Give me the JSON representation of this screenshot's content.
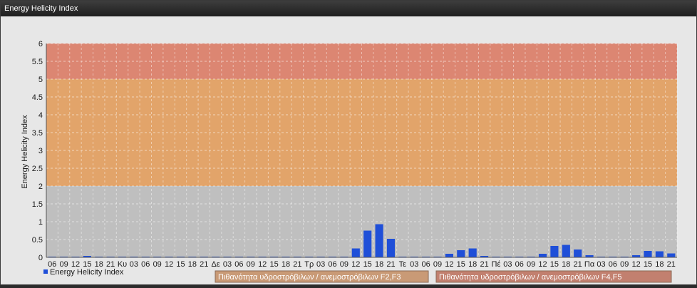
{
  "window": {
    "title": "Energy Helicity Index"
  },
  "chart_data": {
    "type": "bar",
    "ylabel": "Energy Helicity Index",
    "ylim": [
      0,
      6
    ],
    "yticks": [
      "0",
      "0.5",
      "1",
      "1.5",
      "2",
      "2.5",
      "3",
      "3.5",
      "4",
      "4.5",
      "5",
      "5.5",
      "6"
    ],
    "categories": [
      "06",
      "09",
      "12",
      "15",
      "18",
      "21",
      "Κυ",
      "03",
      "06",
      "09",
      "12",
      "15",
      "18",
      "21",
      "Δε",
      "03",
      "06",
      "09",
      "12",
      "15",
      "18",
      "21",
      "Τρ",
      "03",
      "06",
      "09",
      "12",
      "15",
      "18",
      "21",
      "Τε",
      "03",
      "06",
      "09",
      "12",
      "15",
      "18",
      "21",
      "Πέ",
      "03",
      "06",
      "09",
      "12",
      "15",
      "18",
      "21",
      "Πα",
      "03",
      "06",
      "09",
      "12",
      "15",
      "18",
      "21"
    ],
    "series": [
      {
        "name": "Energy Helicity Index",
        "color": "#1f4fd8",
        "values": [
          0.02,
          0.02,
          0.02,
          0.04,
          0.02,
          0.02,
          0.02,
          0.02,
          0.02,
          0.02,
          0.02,
          0.02,
          0.02,
          0.02,
          0.02,
          0.02,
          0.02,
          0.02,
          0.02,
          0.02,
          0.02,
          0.02,
          0.02,
          0.02,
          0.02,
          0.02,
          0.25,
          0.75,
          0.93,
          0.52,
          0.02,
          0.02,
          0.02,
          0.02,
          0.1,
          0.2,
          0.25,
          0.04,
          0.02,
          0.02,
          0.02,
          0.02,
          0.1,
          0.32,
          0.35,
          0.22,
          0.06,
          0.02,
          0.02,
          0.02,
          0.06,
          0.18,
          0.17,
          0.11
        ]
      }
    ],
    "bands": [
      {
        "from": 2,
        "to": 5,
        "color": "#e2a46a",
        "label": "Πιθανότητα υδροστρόβιλων / ανεμοστρόβιλων F2,F3"
      },
      {
        "from": 5,
        "to": 6,
        "color": "#dc8672",
        "label": "Πιθανότητα υδροστρόβιλων / ανεμοστρόβιλων F4,F5"
      }
    ],
    "grid": true
  }
}
